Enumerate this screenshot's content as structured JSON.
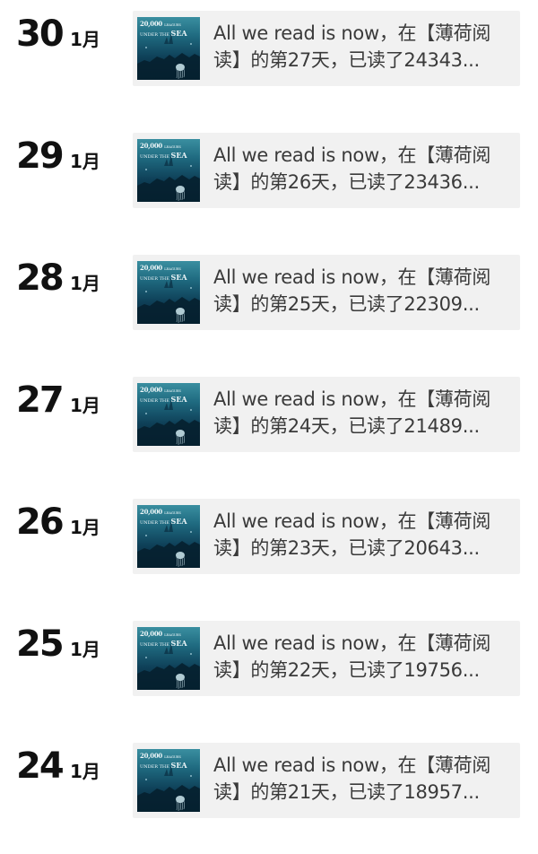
{
  "entries": [
    {
      "day": "30",
      "month": "1月",
      "title_line1": "All we read is now，在【薄荷阅",
      "title_line2": "读】的第27天，已读了24343...",
      "thumbnail": {
        "title_top": "20,000",
        "title_small": "LEAGUES",
        "title_under": "UNDER THE",
        "title_sea": "SEA"
      }
    },
    {
      "day": "29",
      "month": "1月",
      "title_line1": "All we read is now，在【薄荷阅",
      "title_line2": "读】的第26天，已读了23436...",
      "thumbnail": {
        "title_top": "20,000",
        "title_small": "LEAGUES",
        "title_under": "UNDER THE",
        "title_sea": "SEA"
      }
    },
    {
      "day": "28",
      "month": "1月",
      "title_line1": "All we read is now，在【薄荷阅",
      "title_line2": "读】的第25天，已读了22309...",
      "thumbnail": {
        "title_top": "20,000",
        "title_small": "LEAGUES",
        "title_under": "UNDER THE",
        "title_sea": "SEA"
      }
    },
    {
      "day": "27",
      "month": "1月",
      "title_line1": "All we read is now，在【薄荷阅",
      "title_line2": "读】的第24天，已读了21489...",
      "thumbnail": {
        "title_top": "20,000",
        "title_small": "LEAGUES",
        "title_under": "UNDER THE",
        "title_sea": "SEA"
      }
    },
    {
      "day": "26",
      "month": "1月",
      "title_line1": "All we read is now，在【薄荷阅",
      "title_line2": "读】的第23天，已读了20643...",
      "thumbnail": {
        "title_top": "20,000",
        "title_small": "LEAGUES",
        "title_under": "UNDER THE",
        "title_sea": "SEA"
      }
    },
    {
      "day": "25",
      "month": "1月",
      "title_line1": "All we read is now，在【薄荷阅",
      "title_line2": "读】的第22天，已读了19756...",
      "thumbnail": {
        "title_top": "20,000",
        "title_small": "LEAGUES",
        "title_under": "UNDER THE",
        "title_sea": "SEA"
      }
    },
    {
      "day": "24",
      "month": "1月",
      "title_line1": "All we read is now，在【薄荷阅",
      "title_line2": "读】的第21天，已读了18957...",
      "thumbnail": {
        "title_top": "20,000",
        "title_small": "LEAGUES",
        "title_under": "UNDER THE",
        "title_sea": "SEA"
      }
    }
  ],
  "colors": {
    "background": "#ffffff",
    "card_background": "#f1f1f1",
    "date_text": "#111111",
    "card_text": "#3a3a3a",
    "thumbnail_sea_dark": "#072538",
    "thumbnail_sea_light": "#3a8fa0"
  },
  "icons": {
    "thumbnail": "book-cover-image"
  }
}
